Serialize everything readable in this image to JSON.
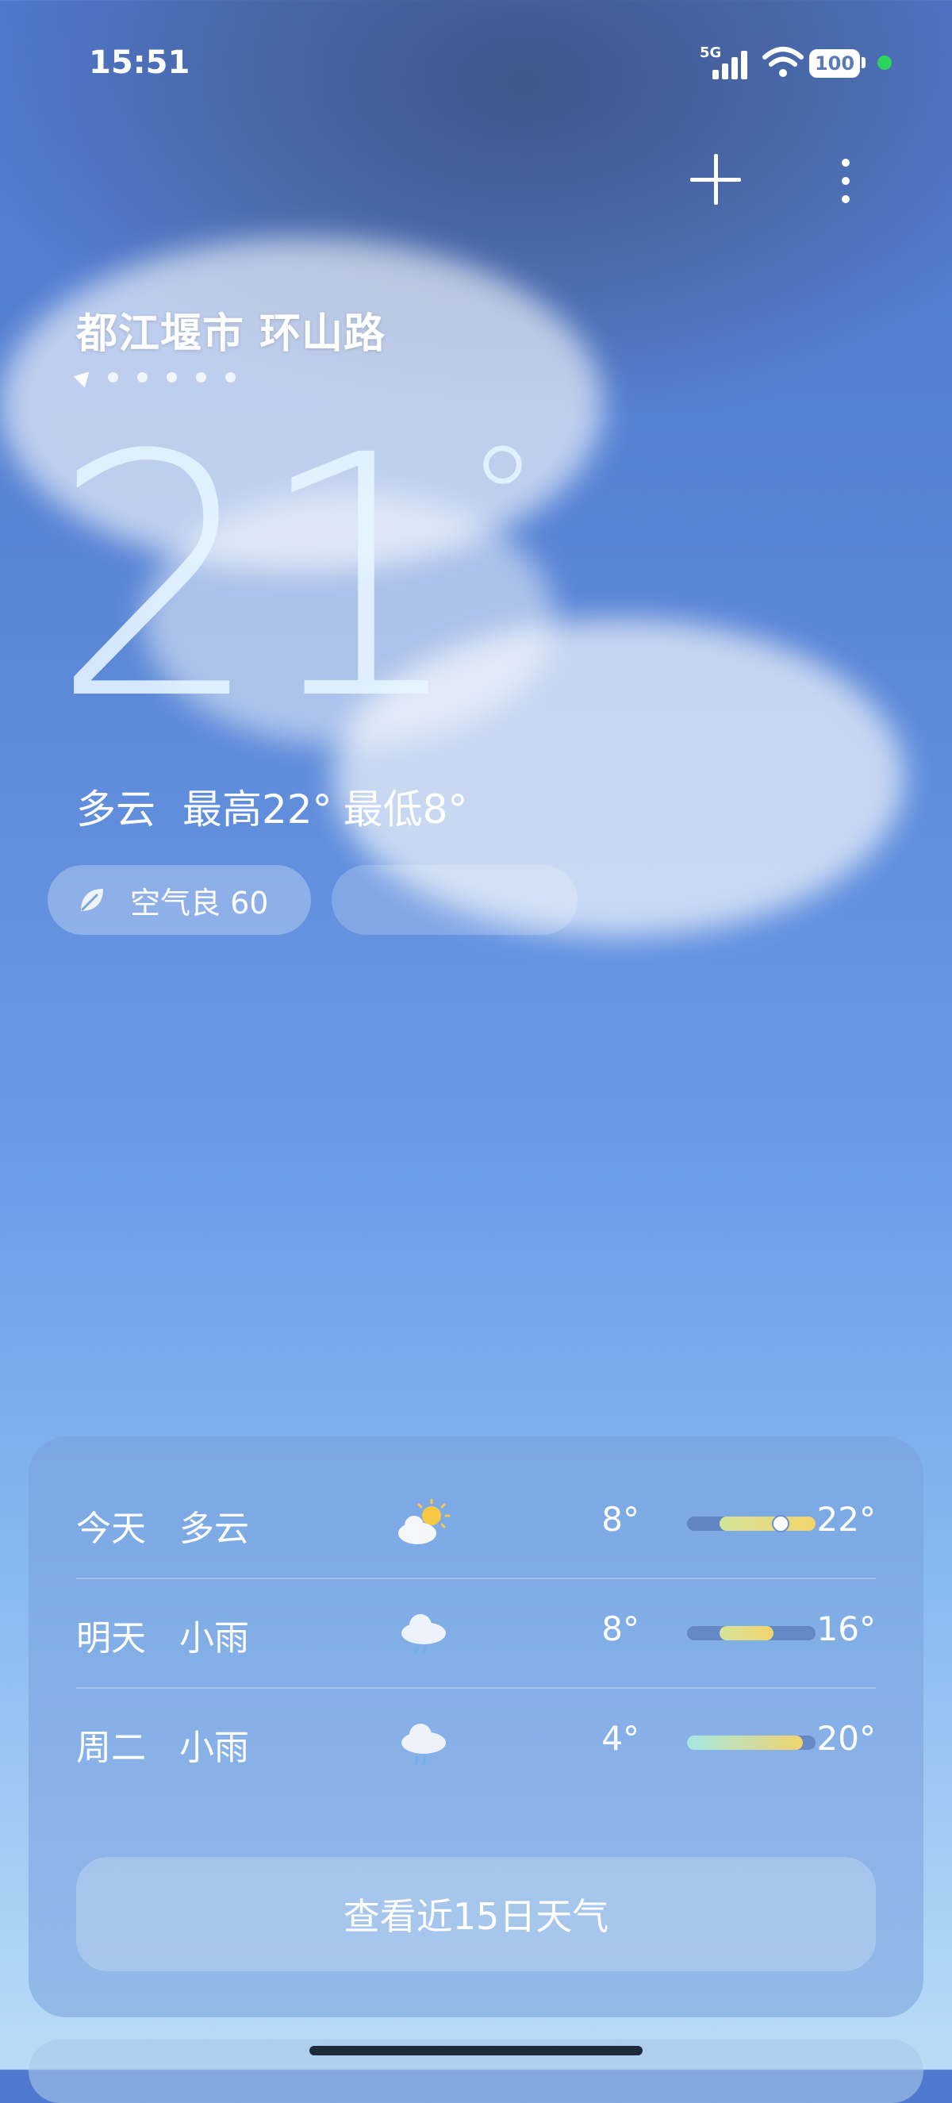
{
  "status_bar": {
    "time": "15:51",
    "network": "5G",
    "battery": "100"
  },
  "header": {
    "location": "都江堰市 环山路"
  },
  "current": {
    "temp": "21",
    "degree_symbol": "°",
    "condition": "多云",
    "high_label": "最高22°",
    "low_label": "最低8°"
  },
  "air_quality": {
    "label": "空气良 60"
  },
  "forecast": [
    {
      "day": "今天",
      "condition": "多云",
      "icon": "partly-cloudy-icon",
      "low": "8°",
      "high": "22°",
      "range": [
        0.25,
        1.0
      ],
      "current": 0.72
    },
    {
      "day": "明天",
      "condition": "小雨",
      "icon": "rain-icon",
      "low": "8°",
      "high": "16°",
      "range": [
        0.25,
        0.67
      ]
    },
    {
      "day": "周二",
      "condition": "小雨",
      "icon": "rain-icon",
      "low": "4°",
      "high": "20°",
      "range": [
        0.0,
        0.9
      ]
    }
  ],
  "forecast_button": "查看近15日天气",
  "colors": {
    "sky_top": "#4f79cf",
    "sky_bottom": "#b9dcf6",
    "status_dot": "#2bd45c",
    "bar_warm": "#f3d46c",
    "bar_cool": "#d4e49a"
  }
}
